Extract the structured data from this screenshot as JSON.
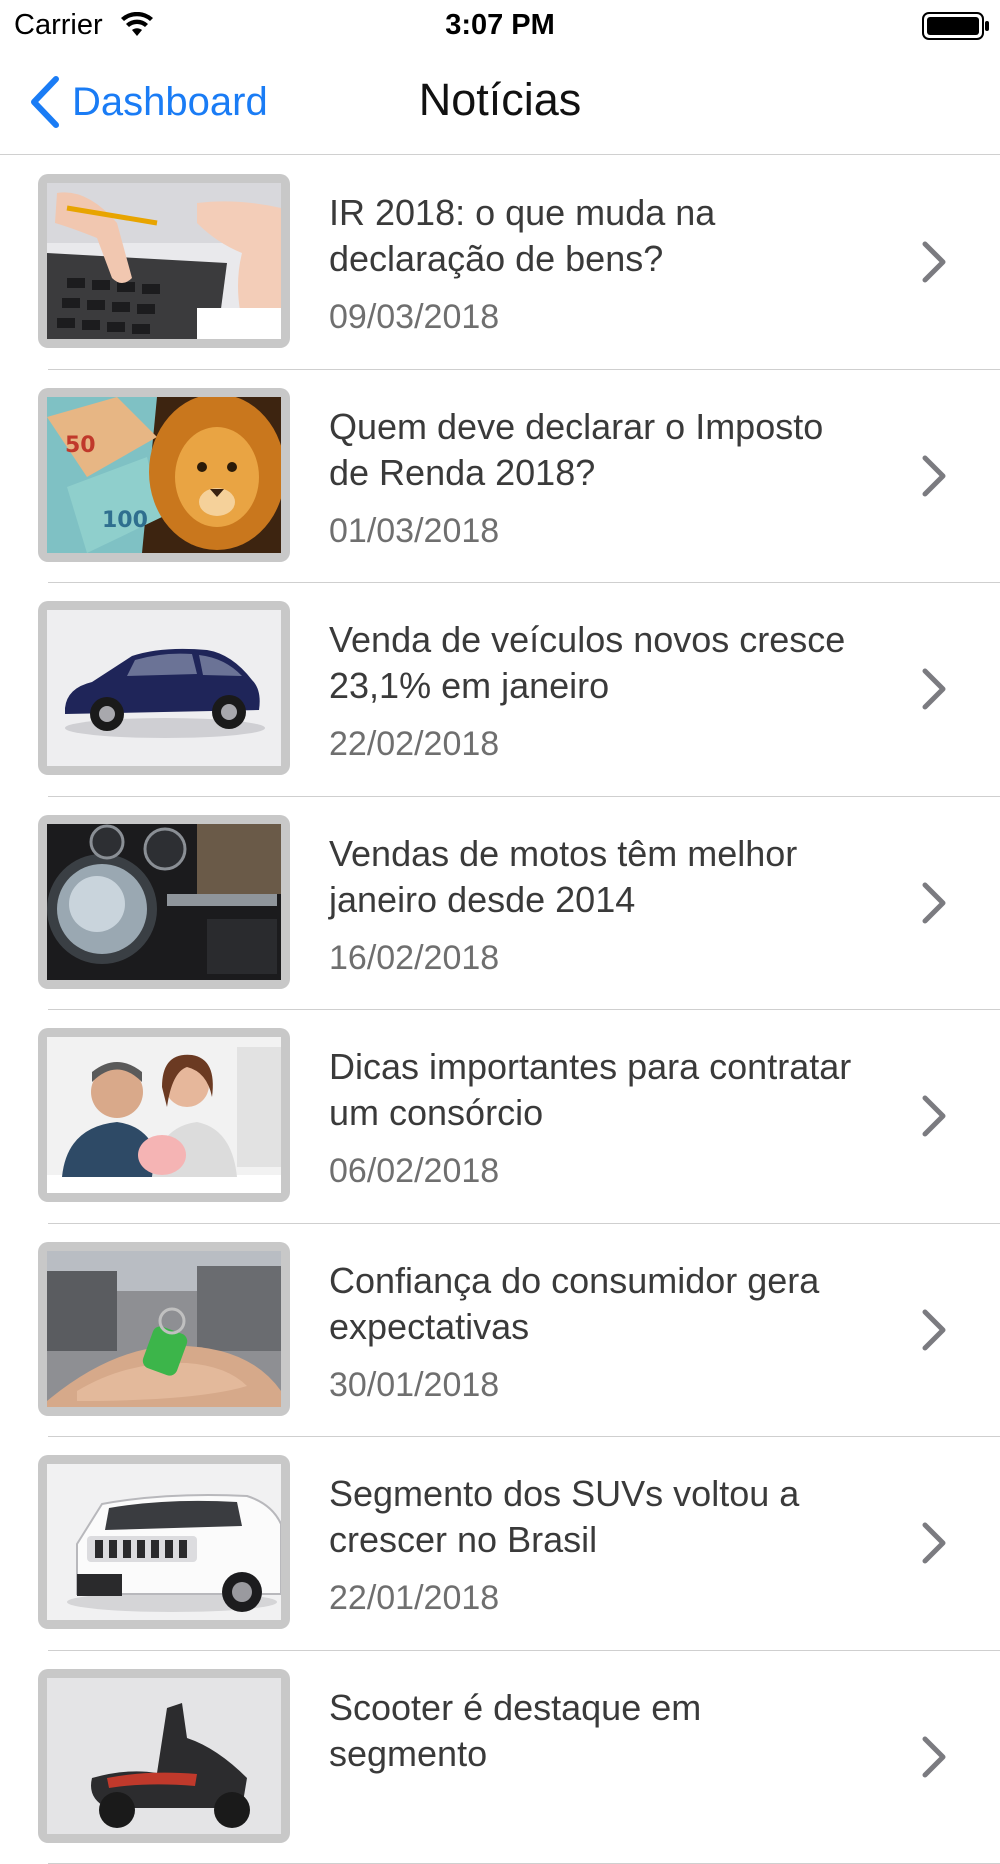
{
  "status": {
    "carrier": "Carrier",
    "time": "3:07 PM"
  },
  "nav": {
    "back_label": "Dashboard",
    "title": "Notícias"
  },
  "news": [
    {
      "title": "IR 2018: o que muda na declaração de bens?",
      "date": "09/03/2018",
      "image": "calculator-hands"
    },
    {
      "title": "Quem deve declarar o Imposto de Renda 2018?",
      "date": "01/03/2018",
      "image": "lion-banknotes"
    },
    {
      "title": "Venda de veículos novos cresce 23,1% em janeiro",
      "date": "22/02/2018",
      "image": "blue-hatchback-car"
    },
    {
      "title": "Vendas de motos têm melhor janeiro desde 2014",
      "date": "16/02/2018",
      "image": "motorcycle-headlight"
    },
    {
      "title": "Dicas importantes para contratar um consórcio",
      "date": "06/02/2018",
      "image": "couple-piggy-bank"
    },
    {
      "title": "Confiança do consumidor gera expectativas",
      "date": "30/01/2018",
      "image": "hand-holding-keys"
    },
    {
      "title": "Segmento dos SUVs voltou a crescer no Brasil",
      "date": "22/01/2018",
      "image": "white-jeep-suv"
    },
    {
      "title": "Scooter é destaque em segmento",
      "date": "",
      "image": "scooter"
    }
  ],
  "colors": {
    "accent": "#1a7cf5",
    "title_text": "#3a3a3a",
    "date_text": "#6f6f6f",
    "separator": "#cfcfcf"
  }
}
